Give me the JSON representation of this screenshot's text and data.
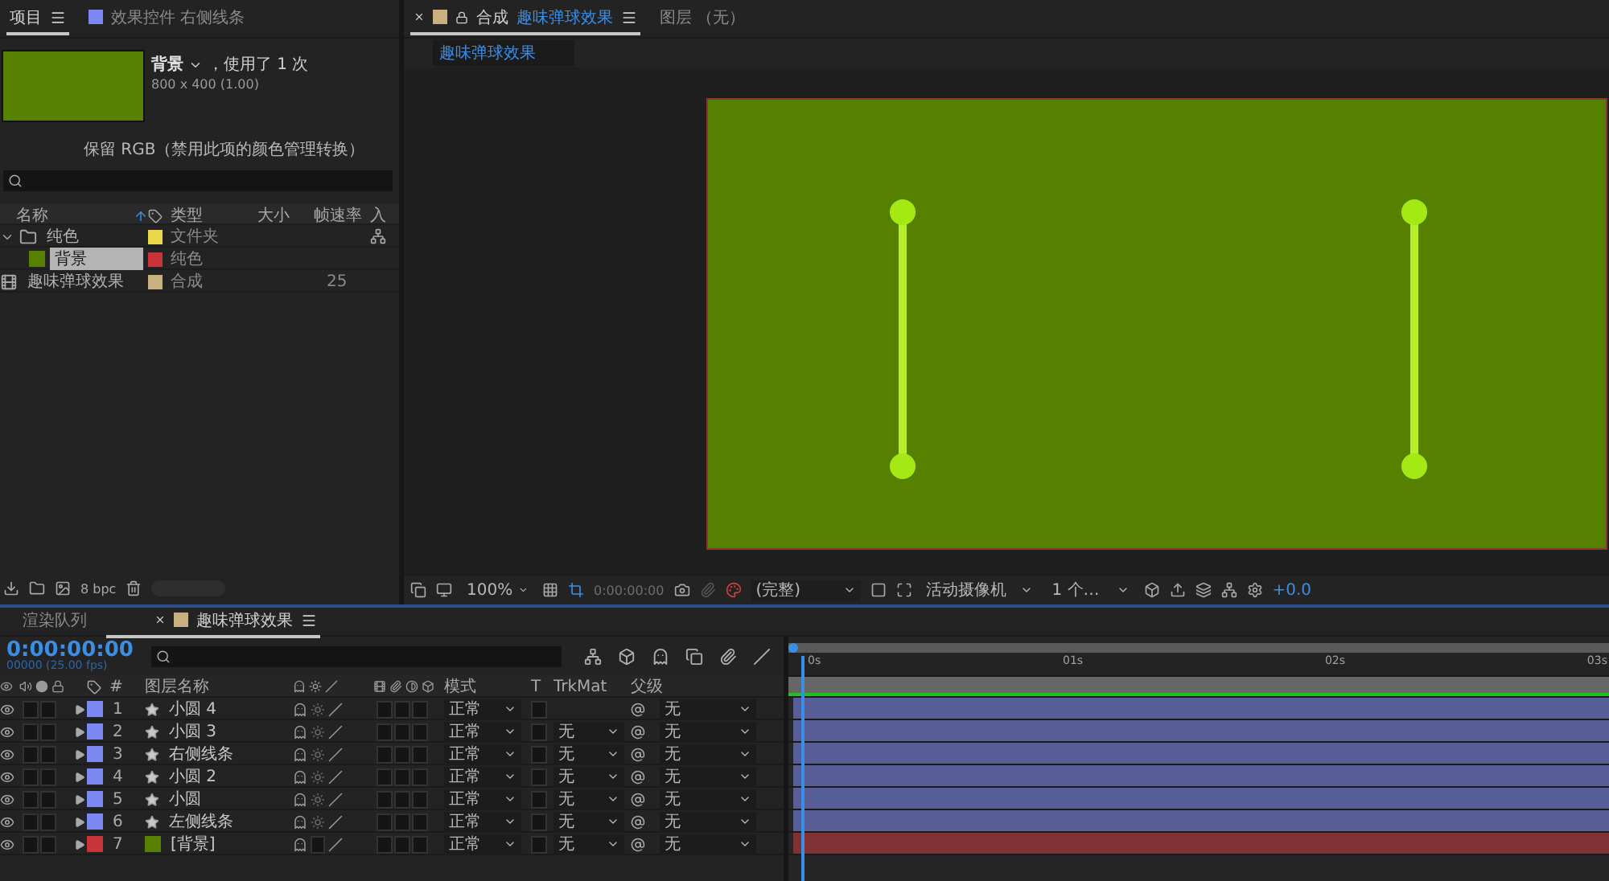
{
  "project_panel": {
    "tabs": [
      {
        "label": "项目",
        "selected": true
      },
      {
        "label": "效果控件 右侧线条",
        "selected": false
      }
    ],
    "preview": {
      "name": "背景",
      "usage": "，使用了 1 次",
      "dimensions": "800 x 400 (1.00)",
      "color_note": "保留 RGB（禁用此项的颜色管理转换）"
    },
    "columns": [
      "名称",
      "类型",
      "大小",
      "帧速率",
      "入"
    ],
    "items": [
      {
        "kind": "folder",
        "name": "纯色",
        "type": "文件夹",
        "color": "#e8d84a",
        "expanded": true,
        "children": [
          {
            "kind": "solid",
            "name": "背景",
            "type": "纯色",
            "color": "#c8343a",
            "selected": true
          }
        ]
      },
      {
        "kind": "comp",
        "name": "趣味弹球效果",
        "type": "合成",
        "fps": "25",
        "color": "#c8b080",
        "selected": false
      }
    ],
    "bpc": "8 bpc"
  },
  "viewer": {
    "tabs": [
      {
        "label": "合成",
        "name": "趣味弹球效果",
        "selected": true
      },
      {
        "label": "图层 （无）",
        "selected": false
      }
    ],
    "breadcrumb": "趣味弹球效果",
    "toolbar": {
      "zoom": "100%",
      "timecode": "0:00:00:00",
      "resolution": "(完整)",
      "camera": "活动摄像机",
      "views": "1 个…",
      "exposure": "+0.0"
    }
  },
  "timeline": {
    "tabs": [
      {
        "label": "渲染队列",
        "selected": false
      },
      {
        "label": "趣味弹球效果",
        "selected": true
      }
    ],
    "time": "0:00:00:00",
    "frame_info": "00000 (25.00 fps)",
    "columns": {
      "number": "#",
      "name": "图层名称",
      "mode": "模式",
      "t": "T",
      "trkmat": "TrkMat",
      "parent": "父级"
    },
    "ruler": [
      "0s",
      "01s",
      "02s",
      "03s"
    ],
    "layers": [
      {
        "number": "1",
        "kind": "shape",
        "name": "小圆 4",
        "color": "#7b88f2",
        "visible": true,
        "mode": "正常",
        "parent": "无"
      },
      {
        "number": "2",
        "kind": "shape",
        "name": "小圆 3",
        "color": "#7b88f2",
        "visible": true,
        "mode": "正常",
        "trkmat": "无",
        "parent": "无"
      },
      {
        "number": "3",
        "kind": "shape",
        "name": "右侧线条",
        "color": "#7b88f2",
        "visible": true,
        "mode": "正常",
        "trkmat": "无",
        "parent": "无"
      },
      {
        "number": "4",
        "kind": "shape",
        "name": "小圆 2",
        "color": "#7b88f2",
        "visible": true,
        "mode": "正常",
        "trkmat": "无",
        "parent": "无"
      },
      {
        "number": "5",
        "kind": "shape",
        "name": "小圆",
        "color": "#7b88f2",
        "visible": true,
        "mode": "正常",
        "trkmat": "无",
        "parent": "无"
      },
      {
        "number": "6",
        "kind": "shape",
        "name": "左侧线条",
        "color": "#7b88f2",
        "visible": true,
        "mode": "正常",
        "trkmat": "无",
        "parent": "无"
      },
      {
        "number": "7",
        "kind": "solid",
        "name": "[背景]",
        "color": "#c8343a",
        "visible": true,
        "mode": "正常",
        "trkmat": "无",
        "parent": "无"
      }
    ]
  }
}
